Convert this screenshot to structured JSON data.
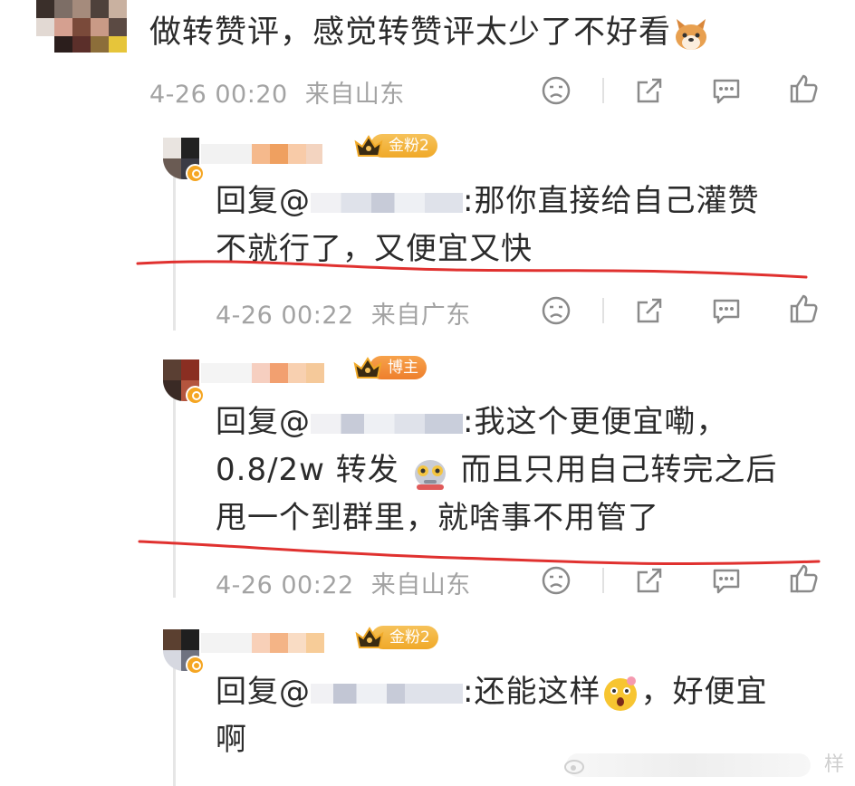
{
  "main_comment": {
    "text": "做转赞评，感觉转赞评太少了不好看",
    "date": "4-26 00:20",
    "location": "来自山东"
  },
  "replies": [
    {
      "badge": "金粉2",
      "text_line1": "回复@",
      "text_body1": ":那你直接给自己灌赞",
      "text_line2": "不就行了，又便宜又快",
      "date": "4-26 00:22",
      "location": "来自广东"
    },
    {
      "badge": "博主",
      "text_line1": "回复@",
      "text_body1": ":我这个更便宜嘞，",
      "text_line2a": "0.8/2w 转发",
      "text_line2b": "而且只用自己转完之后",
      "text_line3": "甩一个到群里，就啥事不用管了",
      "date": "4-26 00:22",
      "location": "来自山东"
    },
    {
      "badge": "金粉2",
      "text_line1": "回复@",
      "text_body1": ":还能这样",
      "text_body2": "，好便宜",
      "text_line2": "啊"
    }
  ],
  "watermark": "样",
  "icons": [
    "dislike-icon",
    "share-icon",
    "comment-icon",
    "like-icon",
    "crown-icon",
    "verified-badge-icon",
    "dog-emoji-icon",
    "robot-emoji-icon",
    "surprised-emoji-icon"
  ],
  "colors": {
    "meta": "#a3a3a3",
    "gold": "#f0a928",
    "host": "#ee7f2c",
    "underline": "#e0312f"
  }
}
